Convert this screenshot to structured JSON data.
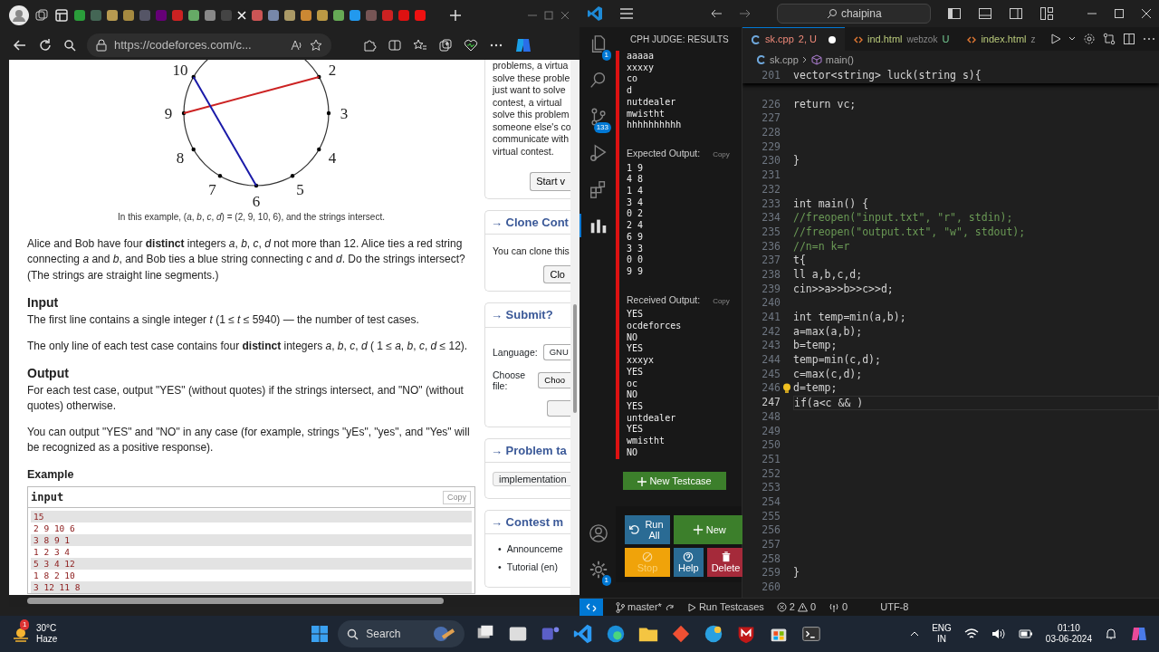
{
  "browser": {
    "address": "https://codeforces.com/c..."
  },
  "problem": {
    "diagram": {
      "labels": [
        "2",
        "3",
        "4",
        "5",
        "6",
        "7",
        "8",
        "9",
        "10"
      ]
    },
    "caption": "In this example, (*a*, *b*, *c*, *d*) = (2, 9, 10, 6), and the strings intersect.",
    "blocks": [
      {
        "kind": "text",
        "text": "Alice and Bob have four **distinct** integers *a*, *b*, *c*, *d* not more than 12. Alice ties a red string connecting *a* and *b*, and Bob ties a blue string connecting *c* and *d*. Do the strings intersect? (The strings are straight line segments.)"
      },
      {
        "kind": "heading",
        "text": "Input"
      },
      {
        "kind": "text",
        "text": "The first line contains a single integer *t* (1 ≤ *t* ≤ 5940) — the number of test cases."
      },
      {
        "kind": "text",
        "text": "The only line of each test case contains four **distinct** integers *a*, *b*, *c*, *d* ( 1 ≤ *a*, *b*, *c*, *d* ≤ 12)."
      },
      {
        "kind": "heading",
        "text": "Output"
      },
      {
        "kind": "text",
        "text": "For each test case, output \"YES\" (without quotes) if the strings intersect, and \"NO\" (without quotes) otherwise."
      },
      {
        "kind": "text",
        "text": "You can output \"YES\" and \"NO\" in any case (for example, strings \"yEs\", \"yes\", and \"Yes\" will be recognized as a positive response)."
      },
      {
        "kind": "subheading",
        "text": "Example"
      }
    ],
    "example": {
      "title": "input",
      "copy": "Copy",
      "lines": [
        "15",
        "2 9 10 6",
        "3 8 9 1",
        "1 2 3 4",
        "5 3 4 12",
        "1 8 2 10",
        "3 12 11 8"
      ]
    }
  },
  "sidebar": [
    {
      "lines": [
        "problems, a virtua",
        "solve these proble",
        "just want to solve",
        "contest, a virtual",
        "solve this problem",
        "someone else's co",
        "communicate with",
        "virtual contest."
      ],
      "button": "Start v"
    },
    {
      "title": "→ Clone Cont",
      "lines": [
        "You can clone this"
      ],
      "button": "Clo"
    },
    {
      "title": "→ Submit?",
      "fields": [
        {
          "label": "Language:",
          "kind": "select",
          "value": "GNU"
        },
        {
          "label": "Choose file:",
          "kind": "file",
          "value": "Choo"
        }
      ],
      "blank_button": true
    },
    {
      "title": "→ Problem ta",
      "tags": [
        "implementation"
      ]
    },
    {
      "title": "→ Contest m",
      "marker": "•",
      "bullets": [
        "Announceme",
        "Tutorial (en)"
      ]
    }
  ],
  "vscode": {
    "search": "chaipina",
    "activity": [
      {
        "kind": "files",
        "badge": "1",
        "selected": false
      },
      {
        "kind": "search",
        "selected": false
      },
      {
        "kind": "source-control",
        "badge": "133",
        "selected": false
      },
      {
        "kind": "run",
        "selected": false
      },
      {
        "kind": "extensions",
        "selected": false
      },
      {
        "kind": "judge",
        "selected": true
      }
    ],
    "activity_bottom": [
      {
        "kind": "account",
        "selected": false
      },
      {
        "kind": "settings",
        "badge": "1",
        "selected": false
      }
    ],
    "cph": {
      "title": "CPH JUDGE: RESULTS",
      "failed": true,
      "input": [
        "aaaaa",
        "xxxxy",
        "co",
        "d",
        "nutdealer",
        "mwistht",
        "hhhhhhhhhh"
      ],
      "expected": {
        "label": "Expected Output:",
        "copy": "Copy",
        "lines": [
          "1 9",
          "4 8",
          "1 4",
          "3 4",
          "0 2",
          "2 4",
          "6 9",
          "3 3",
          "0 0",
          "9 9"
        ]
      },
      "received": {
        "label": "Received Output:",
        "copy": "Copy",
        "lines": [
          "YES",
          "ocdeforces",
          "NO",
          "YES",
          "xxxyx",
          "YES",
          "oc",
          "NO",
          "YES",
          "untdealer",
          "YES",
          "wmistht",
          "NO"
        ]
      },
      "new_testcase": "New Testcase",
      "buttons": [
        {
          "kind": "run",
          "label": "Run All",
          "disabled": false
        },
        {
          "kind": "new",
          "label": "New",
          "disabled": false
        },
        {
          "kind": "stop",
          "label": "Stop",
          "disabled": true
        },
        {
          "kind": "help",
          "label": "Help",
          "disabled": false
        },
        {
          "kind": "delete",
          "label": "Delete",
          "disabled": false
        }
      ]
    },
    "tabs": [
      {
        "kind": "cpp",
        "name": "sk.cpp",
        "status": "2, U",
        "modified": true,
        "selected": true
      },
      {
        "kind": "html",
        "name": "ind.html",
        "detail": "webzok",
        "status": "U",
        "modified": false,
        "selected": false
      },
      {
        "kind": "html",
        "name": "index.html",
        "detail": "z",
        "modified": false,
        "selected": false
      }
    ],
    "breadcrumb": [
      "sk.cpp",
      "main()"
    ],
    "lines": [
      {
        "number": "201",
        "code": "vector<string> luck(string s){",
        "kind": "code",
        "sticky": true
      },
      {
        "number": "226",
        "code": "return vc;",
        "kind": "code"
      },
      {
        "number": "227"
      },
      {
        "number": "228"
      },
      {
        "number": "229"
      },
      {
        "number": "230",
        "code": "}",
        "kind": "code"
      },
      {
        "number": "231"
      },
      {
        "number": "232"
      },
      {
        "number": "233",
        "code": "int main() {",
        "kind": "code"
      },
      {
        "number": "234",
        "code": "//freopen(\"input.txt\", \"r\", stdin);",
        "kind": "comment"
      },
      {
        "number": "235",
        "code": "//freopen(\"output.txt\", \"w\", stdout);",
        "kind": "comment"
      },
      {
        "number": "236",
        "code": "//n=n k=r",
        "kind": "comment"
      },
      {
        "number": "237",
        "code": "t{",
        "kind": "code"
      },
      {
        "number": "238",
        "code": "ll a,b,c,d;",
        "kind": "code"
      },
      {
        "number": "239",
        "code": "cin>>a>>b>>c>>d;",
        "kind": "code"
      },
      {
        "number": "240"
      },
      {
        "number": "241",
        "code": "int temp=min(a,b);",
        "kind": "code"
      },
      {
        "number": "242",
        "code": "a=max(a,b);",
        "kind": "code"
      },
      {
        "number": "243",
        "code": "b=temp;",
        "kind": "code"
      },
      {
        "number": "244",
        "code": "temp=min(c,d);",
        "kind": "code"
      },
      {
        "number": "245",
        "code": "c=max(c,d);",
        "kind": "code"
      },
      {
        "number": "246",
        "code": "d=temp;",
        "kind": "code",
        "bulb": true
      },
      {
        "number": "247",
        "code": "if(a<c && )",
        "kind": "code",
        "current": true
      },
      {
        "number": "248"
      },
      {
        "number": "249"
      },
      {
        "number": "250"
      },
      {
        "number": "251"
      },
      {
        "number": "252"
      },
      {
        "number": "253"
      },
      {
        "number": "254"
      },
      {
        "number": "255"
      },
      {
        "number": "256"
      },
      {
        "number": "257"
      },
      {
        "number": "258"
      },
      {
        "number": "259",
        "code": "}",
        "kind": "code"
      },
      {
        "number": "260"
      }
    ],
    "status": [
      {
        "kind": "remote"
      },
      {
        "kind": "branch",
        "text": "master*"
      },
      {
        "kind": "run",
        "text": "Run Testcases"
      },
      {
        "kind": "problems",
        "errors": "2",
        "warnings": "0"
      },
      {
        "kind": "ports",
        "text": "0"
      },
      {
        "kind": "plain",
        "text": "UTF-8"
      }
    ]
  },
  "taskbar": {
    "weather": {
      "temp": "30°C",
      "condition": "Haze",
      "badge": "1"
    },
    "search": "Search",
    "apps": [
      {
        "kind": "widgets"
      },
      {
        "kind": "files-window"
      },
      {
        "kind": "teams"
      },
      {
        "kind": "vscode"
      },
      {
        "kind": "edge"
      },
      {
        "kind": "folder"
      },
      {
        "kind": "git"
      },
      {
        "kind": "help"
      },
      {
        "kind": "antivirus"
      },
      {
        "kind": "store"
      },
      {
        "kind": "terminal"
      }
    ],
    "lang": [
      "ENG",
      "IN"
    ],
    "time": "01:10",
    "date": "03-06-2024"
  }
}
